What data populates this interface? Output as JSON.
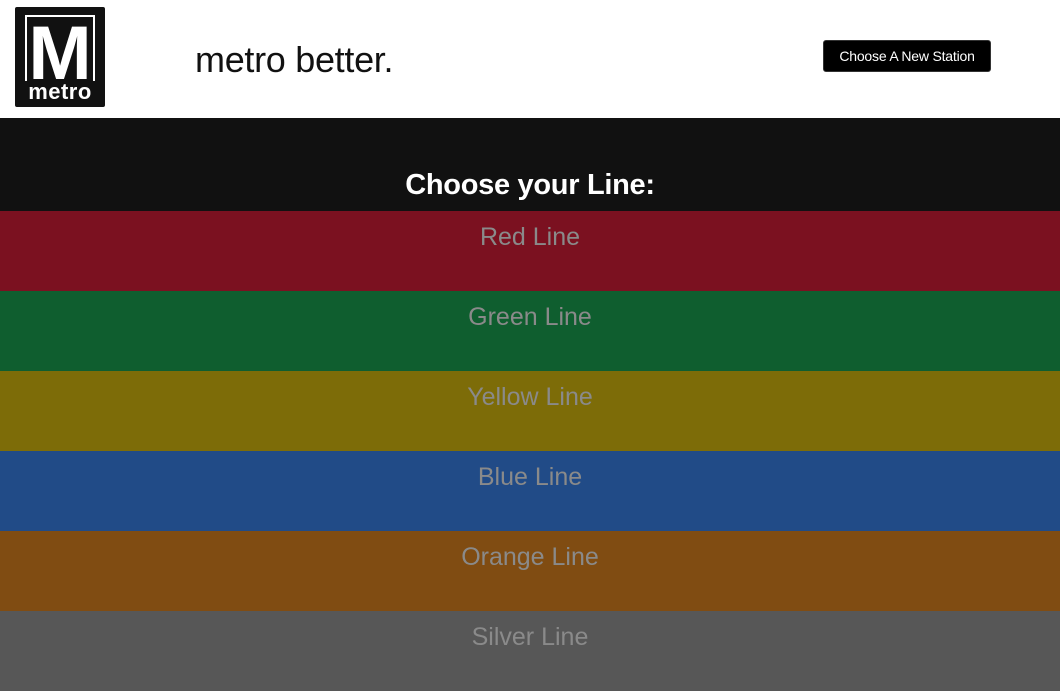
{
  "header": {
    "logo": {
      "letter": "M",
      "word": "metro"
    },
    "tagline": "metro better.",
    "new_station_button": "Choose A New Station"
  },
  "main": {
    "prompt": "Choose your Line:",
    "lines": [
      {
        "label": "Red Line",
        "color": "#7b1120"
      },
      {
        "label": "Green Line",
        "color": "#0f5e2f"
      },
      {
        "label": "Yellow Line",
        "color": "#7d6c08"
      },
      {
        "label": "Blue Line",
        "color": "#214b87"
      },
      {
        "label": "Orange Line",
        "color": "#804c12"
      },
      {
        "label": "Silver Line",
        "color": "#575757"
      }
    ]
  },
  "colors": {
    "header_bg": "#ffffff",
    "page_bg": "#111111",
    "line_text": "#8a8a8a"
  }
}
